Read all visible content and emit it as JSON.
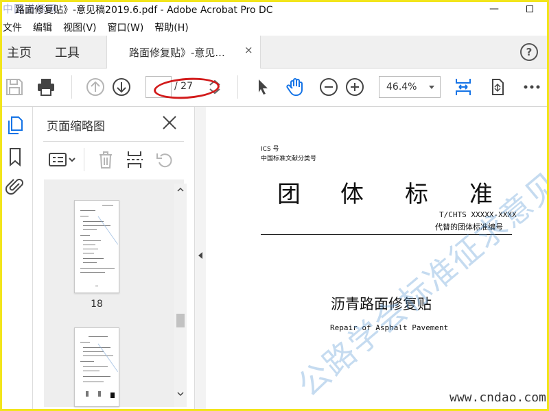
{
  "app": {
    "title_watermark": "中国道标网",
    "title": "路面修复贴》-意见稿2019.6.pdf - Adobe Acrobat Pro DC",
    "window_controls": [
      "minimize-icon",
      "maximize-icon"
    ]
  },
  "menu": [
    "文件",
    "编辑",
    "视图(V)",
    "窗口(W)",
    "帮助(H)"
  ],
  "tabs": {
    "home": "主页",
    "tools": "工具",
    "document": "路面修复贴》-意见...",
    "close_glyph": "×",
    "help_glyph": "?"
  },
  "toolbar": {
    "page_total": "/ 27",
    "zoom": "46.4%",
    "icons": [
      "save-icon",
      "print-icon",
      "prev-page-icon",
      "next-page-icon",
      "select-cursor-icon",
      "hand-icon",
      "zoom-out-icon",
      "zoom-in-icon",
      "fit-page-icon",
      "rotate-view-icon",
      "more-icon"
    ]
  },
  "rail": {
    "icons": [
      "page-thumbnails-icon",
      "bookmarks-icon",
      "attachments-icon"
    ]
  },
  "panel": {
    "title": "页面缩略图",
    "thumbnails": [
      {
        "label": "18"
      },
      {
        "label": ""
      }
    ]
  },
  "document": {
    "ics": "ICS 号",
    "classification": "中国标准文献分类号",
    "heading_chars": [
      "团",
      "体",
      "标",
      "准"
    ],
    "code": "T/CHTS XXXXX-XXXX",
    "replaces": "代替的团体标准编号",
    "title_cn": "沥青路面修复贴",
    "title_en": "Repair of Asphalt Pavement",
    "watermark": "公路学会标准征求意见稿",
    "site_watermark": "www.cndao.com"
  },
  "colors": {
    "accent_blue": "#1473e6",
    "highlight_red": "#d21a1a",
    "frame_yellow": "#f2e51c"
  }
}
